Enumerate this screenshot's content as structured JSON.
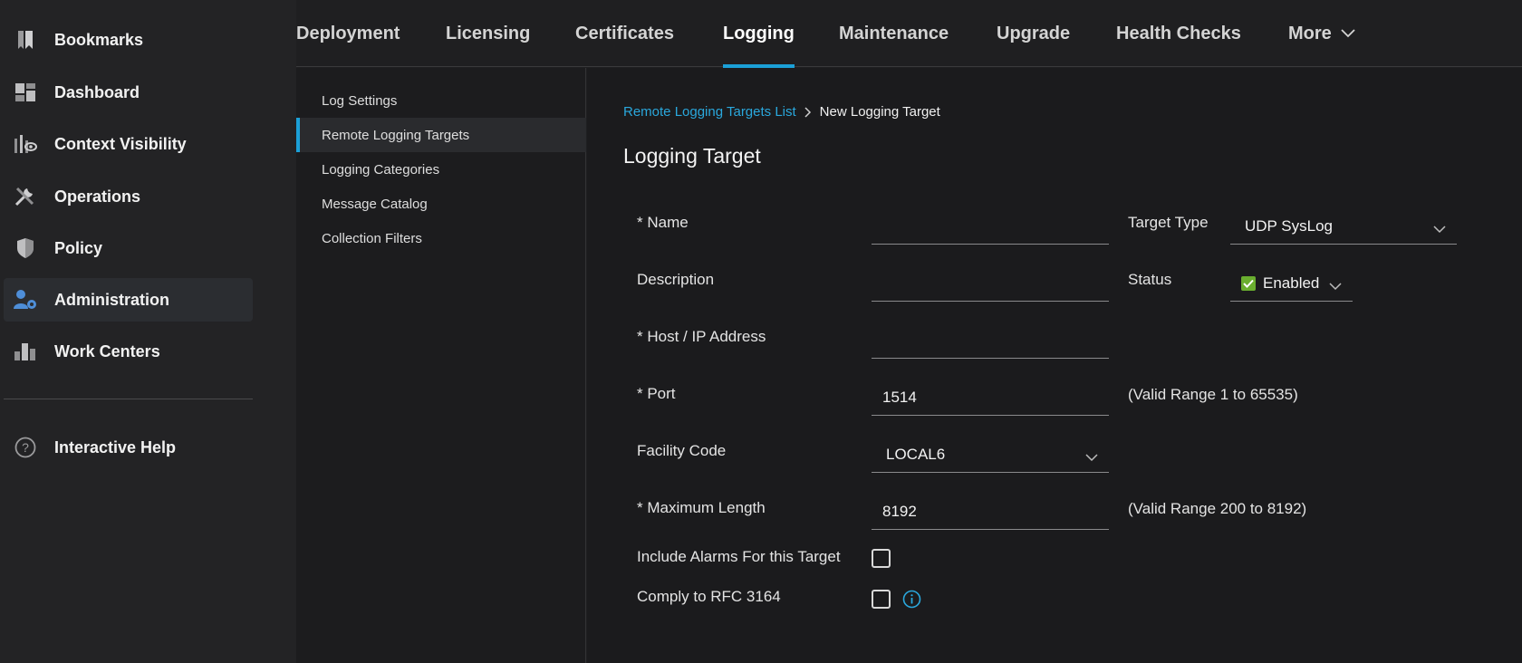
{
  "sidebar": {
    "items": [
      {
        "label": "Bookmarks",
        "icon": "bookmark-icon"
      },
      {
        "label": "Dashboard",
        "icon": "dashboard-icon"
      },
      {
        "label": "Context Visibility",
        "icon": "context-visibility-icon"
      },
      {
        "label": "Operations",
        "icon": "tools-icon"
      },
      {
        "label": "Policy",
        "icon": "shield-icon"
      },
      {
        "label": "Administration",
        "icon": "admin-user-gear-icon",
        "active": true
      },
      {
        "label": "Work Centers",
        "icon": "work-centers-icon"
      }
    ],
    "help": {
      "label": "Interactive Help",
      "icon": "help-circle-icon"
    }
  },
  "tabs": [
    {
      "label": "Deployment"
    },
    {
      "label": "Licensing"
    },
    {
      "label": "Certificates"
    },
    {
      "label": "Logging",
      "active": true
    },
    {
      "label": "Maintenance"
    },
    {
      "label": "Upgrade"
    },
    {
      "label": "Health Checks"
    },
    {
      "label": "More",
      "icon": "chevron-down-icon"
    }
  ],
  "submenu": {
    "items": [
      {
        "label": "Log Settings"
      },
      {
        "label": "Remote Logging Targets",
        "active": true
      },
      {
        "label": "Logging Categories"
      },
      {
        "label": "Message Catalog"
      },
      {
        "label": "Collection Filters"
      }
    ]
  },
  "breadcrumb": {
    "parent": "Remote Logging Targets List",
    "current": "New Logging Target"
  },
  "page_title": "Logging Target",
  "form": {
    "name": {
      "label": "* Name",
      "value": ""
    },
    "description": {
      "label": "Description",
      "value": ""
    },
    "host": {
      "label": "* Host / IP Address",
      "value": ""
    },
    "port": {
      "label": "* Port",
      "value": "1514",
      "hint": "(Valid Range 1 to 65535)"
    },
    "facility": {
      "label": "Facility Code",
      "value": "LOCAL6"
    },
    "max_length": {
      "label": "* Maximum Length",
      "value": "8192",
      "hint": "(Valid Range 200 to 8192)"
    },
    "include_alarms": {
      "label": "Include Alarms For this Target",
      "checked": false
    },
    "comply_rfc": {
      "label": "Comply to RFC 3164",
      "checked": false,
      "info_icon": "info-circle-icon"
    },
    "target_type": {
      "label": "Target Type",
      "value": "UDP SysLog"
    },
    "status": {
      "label": "Status",
      "value": "Enabled",
      "checked": true
    }
  },
  "colors": {
    "accent": "#1ba0d7",
    "status_green": "#6aae2f",
    "background": "#1f1f21"
  }
}
